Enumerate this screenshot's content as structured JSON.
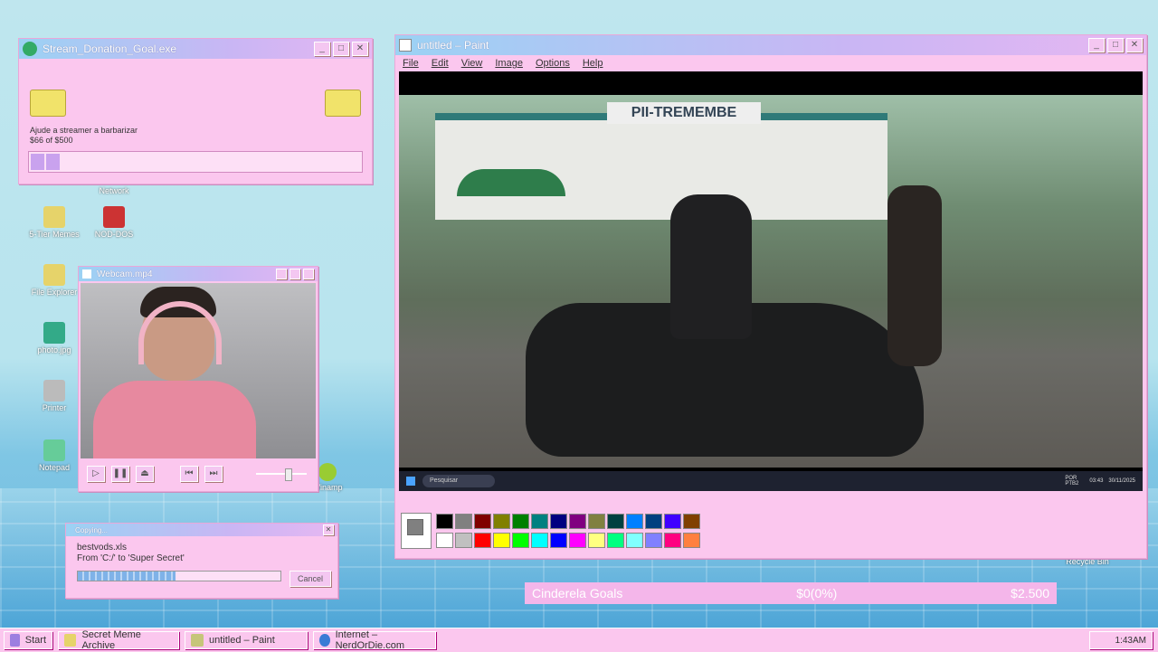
{
  "donation": {
    "title": "Stream_Donation_Goal.exe",
    "text": "Ajude a streamer a barbarizar",
    "amount": "$66 of $500",
    "progress": 0.132
  },
  "desktop_icons": [
    {
      "label": "Network",
      "color": "#7aa"
    },
    {
      "label": "5-Tier Memes",
      "color": "#e6d36a"
    },
    {
      "label": "NOD-DOS",
      "color": "#c33"
    },
    {
      "label": "File Explorer",
      "color": "#5b8"
    },
    {
      "label": "photo.jpg",
      "color": "#3a8"
    },
    {
      "label": "Printer",
      "color": "#bbb"
    },
    {
      "label": "Notepad",
      "color": "#6c9"
    },
    {
      "label": "Recycle Bin",
      "color": "#aaa"
    },
    {
      "label": "Winamp",
      "color": "#9c3"
    }
  ],
  "webcam": {
    "title": "Webcam.mp4"
  },
  "copying": {
    "title": "Copying...",
    "file": "bestvods.xls",
    "path": "From 'C:/' to 'Super Secret'",
    "cancel": "Cancel",
    "progress": 0.48
  },
  "paint": {
    "title": "untitled – Paint",
    "menu": [
      "File",
      "Edit",
      "View",
      "Image",
      "Options",
      "Help"
    ],
    "inner_taskbar": {
      "search": "Pesquisar",
      "lang": "POR\nPTB2",
      "time": "03:43",
      "date": "30/11/2025"
    },
    "palette_top": [
      "#000000",
      "#808080",
      "#800000",
      "#808000",
      "#008000",
      "#008080",
      "#000080",
      "#800080",
      "#808040",
      "#004040",
      "#0080ff",
      "#004080",
      "#4000ff",
      "#804000"
    ],
    "palette_bottom": [
      "#ffffff",
      "#c0c0c0",
      "#ff0000",
      "#ffff00",
      "#00ff00",
      "#00ffff",
      "#0000ff",
      "#ff00ff",
      "#ffff80",
      "#00ff80",
      "#80ffff",
      "#8080ff",
      "#ff0080",
      "#ff8040"
    ]
  },
  "goal_bar": {
    "label": "Cinderela Goals",
    "value": "$0(0%)",
    "target": "$2.500"
  },
  "taskbar": {
    "start": "Start",
    "items": [
      "Secret Meme Archive",
      "untitled – Paint",
      "Internet – NerdOrDie.com"
    ],
    "clock": "1:43AM"
  }
}
